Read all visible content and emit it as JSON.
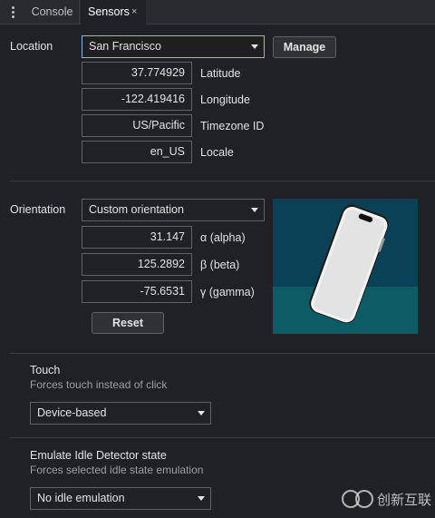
{
  "tabs": {
    "menu_icon": "kebab-menu-icon",
    "console": "Console",
    "sensors": "Sensors",
    "close": "×"
  },
  "location": {
    "label": "Location",
    "selected": "San Francisco",
    "manage_button": "Manage",
    "latitude": {
      "value": "37.774929",
      "label": "Latitude"
    },
    "longitude": {
      "value": "-122.419416",
      "label": "Longitude"
    },
    "timezone": {
      "value": "US/Pacific",
      "label": "Timezone ID"
    },
    "locale": {
      "value": "en_US",
      "label": "Locale"
    }
  },
  "orientation": {
    "label": "Orientation",
    "selected": "Custom orientation",
    "alpha": {
      "value": "31.147",
      "label": "α (alpha)"
    },
    "beta": {
      "value": "125.2892",
      "label": "β (beta)"
    },
    "gamma": {
      "value": "-75.6531",
      "label": "γ (gamma)"
    },
    "reset_button": "Reset",
    "preview_colors": {
      "sky": "#0b4156",
      "floor": "#0d5b65",
      "phone": "#e8e8e8"
    }
  },
  "touch": {
    "title": "Touch",
    "subtitle": "Forces touch instead of click",
    "selected": "Device-based"
  },
  "idle": {
    "title": "Emulate Idle Detector state",
    "subtitle": "Forces selected idle state emulation",
    "selected": "No idle emulation"
  },
  "watermark": {
    "text": "创新互联"
  }
}
